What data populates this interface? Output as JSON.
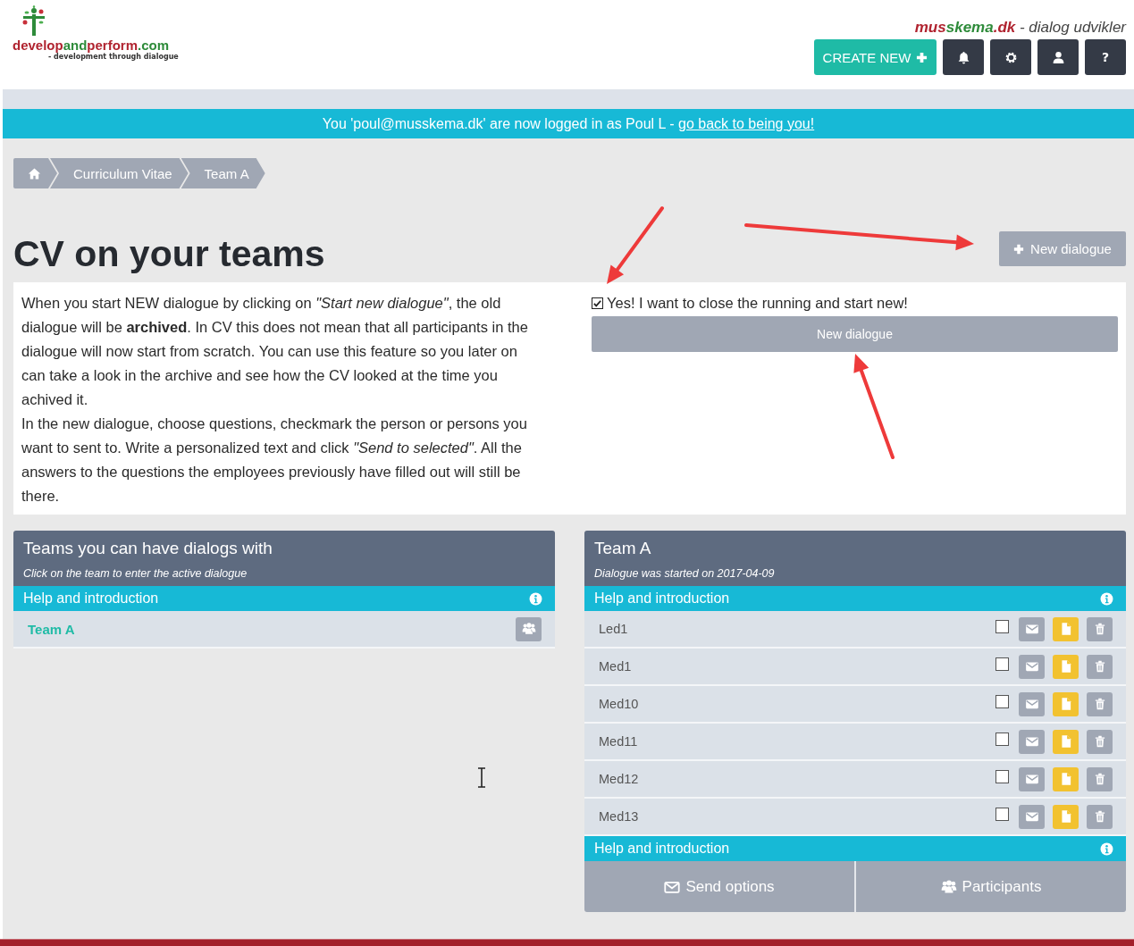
{
  "logo": {
    "parts": [
      {
        "text": "develop",
        "color": "#b0232f"
      },
      {
        "text": "and",
        "color": "#2e8b3a"
      },
      {
        "text": "perform",
        "color": "#b0232f"
      },
      {
        "text": ".com",
        "color": "#2e8b3a"
      }
    ],
    "tagline": "- development through dialogue"
  },
  "brand": {
    "parts": [
      {
        "text": "mus",
        "color": "#b0232f"
      },
      {
        "text": "skema",
        "color": "#2e8b3a"
      },
      {
        "text": ".dk",
        "color": "#b0232f"
      }
    ],
    "suffix": " - dialog udvikler"
  },
  "toolbar": {
    "create_label": "CREATE NEW",
    "icon_buttons": [
      {
        "kind": "bell"
      },
      {
        "kind": "gear"
      },
      {
        "kind": "user"
      },
      {
        "kind": "text",
        "label": "?"
      }
    ]
  },
  "impersonation_bar": {
    "text": "You 'poul@musskema.dk' are now logged in as Poul L - ",
    "link": "go back to being you!"
  },
  "breadcrumb": [
    {
      "kind": "home"
    },
    {
      "kind": "text",
      "label": "Curriculum Vitae"
    },
    {
      "kind": "text",
      "label": "Team A"
    }
  ],
  "page_title": "CV on your teams",
  "new_dialogue_button": "New dialogue",
  "intro": {
    "paragraphs": [
      "When you start NEW dialogue by clicking on *\"Start new dialogue\"*, the old dialogue will be **archived**. In CV this does not mean that all participants in the dialogue will now start from scratch. You can use this feature so you later on can take a look in the archive and see how the CV looked at the time you achived it.",
      "In the new dialogue, choose questions, checkmark the person or persons you want to sent to. Write a personalized text and click *\"Send to selected\"*. All the answers to the questions the employees previously have filled out will still be there."
    ],
    "confirm": {
      "label": "Yes! I want to close the running and start new!",
      "checked": true
    },
    "submit": "New dialogue"
  },
  "teams_panel": {
    "title": "Teams you can have dialogs with",
    "subtitle": "Click on the team to enter the active dialogue",
    "help": "Help and introduction",
    "teams": [
      {
        "name": "Team A"
      }
    ]
  },
  "team_panel": {
    "title": "Team A",
    "subtitle": "Dialogue was started on 2017-04-09",
    "help": "Help and introduction",
    "members": [
      {
        "name": "Led1",
        "checked": false
      },
      {
        "name": "Med1",
        "checked": false
      },
      {
        "name": "Med10",
        "checked": false
      },
      {
        "name": "Med11",
        "checked": false
      },
      {
        "name": "Med12",
        "checked": false
      },
      {
        "name": "Med13",
        "checked": false
      }
    ],
    "help_bottom": "Help and introduction",
    "footer_buttons": [
      {
        "kind": "mail",
        "label": "Send options"
      },
      {
        "kind": "users",
        "label": "Participants"
      }
    ]
  }
}
